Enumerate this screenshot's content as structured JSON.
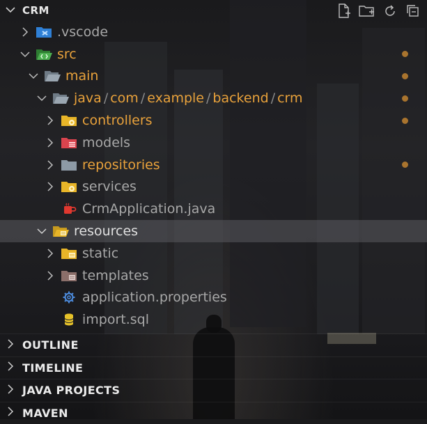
{
  "explorer": {
    "title": "CRM",
    "actions": [
      {
        "name": "new-file-icon",
        "label": "New File"
      },
      {
        "name": "new-folder-icon",
        "label": "New Folder"
      },
      {
        "name": "refresh-icon",
        "label": "Refresh Explorer"
      },
      {
        "name": "collapse-all-icon",
        "label": "Collapse Folders in Explorer"
      }
    ]
  },
  "tree": {
    "vscode": ".vscode",
    "src": "src",
    "main": "main",
    "java_path": [
      "java",
      "com",
      "example",
      "backend",
      "crm"
    ],
    "java_sep": "/",
    "controllers": "controllers",
    "models": "models",
    "repositories": "repositories",
    "services": "services",
    "crm_application": "CrmApplication.java",
    "resources": "resources",
    "static": "static",
    "templates": "templates",
    "application_properties": "application.properties",
    "import_sql": "import.sql"
  },
  "sections": {
    "outline": "OUTLINE",
    "timeline": "TIMELINE",
    "java_projects": "JAVA PROJECTS",
    "maven": "MAVEN"
  },
  "colors": {
    "git_modified": "#e9a23b",
    "git_dot": "#a9742e",
    "selection": "#4a4a50",
    "folder_yellow": "#e8b528",
    "folder_red": "#d9444e",
    "folder_grey": "#8d9aa6",
    "java_red": "#e0382f",
    "gear_blue": "#4d8de0",
    "db_yellow": "#e6c229",
    "vscode_blue": "#2f80d6",
    "src_green": "#4caf50"
  }
}
